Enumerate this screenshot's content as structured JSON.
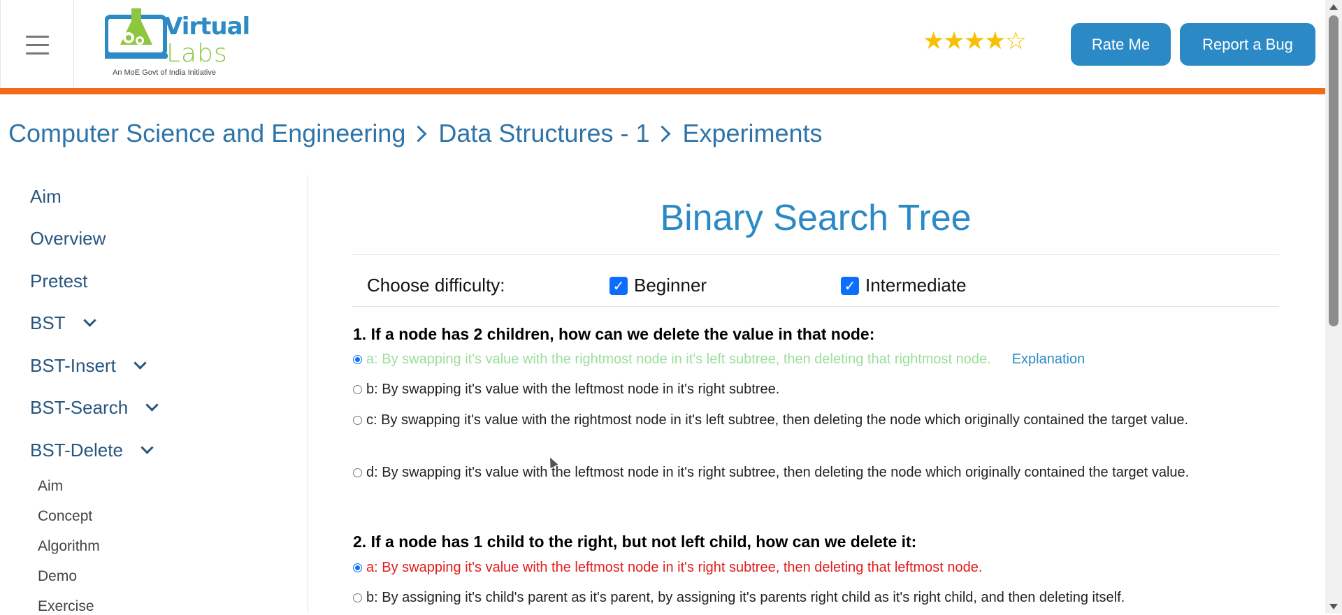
{
  "header": {
    "logo": {
      "word1": "Virtual",
      "word2": "Labs",
      "tagline": "An MoE Govt of India Initiative"
    },
    "rating": 4,
    "rating_max": 5,
    "rate_button": "Rate Me",
    "bug_button": "Report a Bug",
    "accent_color": "#f26a13",
    "button_color": "#2b8ac6"
  },
  "breadcrumb": [
    "Computer Science and Engineering",
    "Data Structures - 1",
    "Experiments"
  ],
  "sidebar": {
    "items": [
      {
        "label": "Aim"
      },
      {
        "label": "Overview"
      },
      {
        "label": "Pretest"
      },
      {
        "label": "BST",
        "expandable": true
      },
      {
        "label": "BST-Insert",
        "expandable": true
      },
      {
        "label": "BST-Search",
        "expandable": true
      },
      {
        "label": "BST-Delete",
        "expandable": true,
        "expanded": true
      }
    ],
    "subitems": [
      "Aim",
      "Concept",
      "Algorithm",
      "Demo",
      "Exercise"
    ]
  },
  "main": {
    "title": "Binary Search Tree",
    "difficulty_label": "Choose difficulty:",
    "difficulties": [
      {
        "label": "Beginner",
        "checked": true
      },
      {
        "label": "Intermediate",
        "checked": true
      }
    ],
    "questions": [
      {
        "text": "1. If a node has 2 children, how can we delete the value in that node:",
        "options": [
          {
            "text": "a: By swapping it's value with the rightmost node in it's left subtree, then deleting that rightmost node.",
            "selected": true,
            "state": "correct"
          },
          {
            "text": "b: By swapping it's value with the leftmost node in it's right subtree."
          },
          {
            "text": "c: By swapping it's value with the rightmost node in it's left subtree, then deleting the node which originally contained the target value."
          },
          {
            "text": "d: By swapping it's value with the leftmost node in it's right subtree, then deleting the node which originally contained the target value."
          }
        ],
        "explanation_link": "Explanation"
      },
      {
        "text": "2. If a node has 1 child to the right, but not left child, how can we delete it:",
        "options": [
          {
            "text": "a: By swapping it's value with the leftmost node in it's right subtree, then deleting that leftmost node.",
            "selected": true,
            "state": "wrong"
          },
          {
            "text": "b: By assigning it's child's parent as it's parent, by assigning it's parents right child as it's right child, and then deleting itself."
          }
        ]
      }
    ]
  }
}
